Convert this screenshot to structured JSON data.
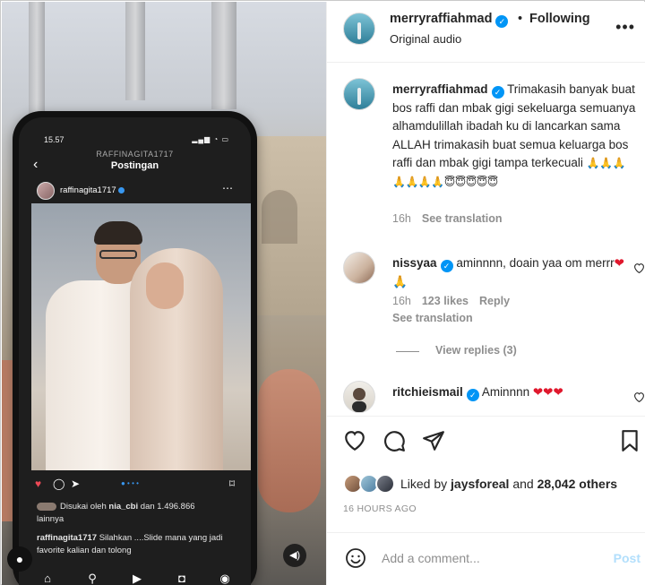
{
  "phone": {
    "status_time": "15.57",
    "nav_username": "RAFFINAGITA1717",
    "nav_title": "Postingan",
    "post_username": "raffinagita1717",
    "likes_prefix": "Disukai oleh",
    "likes_user": "nia_cbi",
    "likes_suffix": "dan 1.496.866",
    "likes_line2": "lainnya",
    "caption_user": "raffinagita1717",
    "caption_text": "Silahkan ....Slide mana yang jadi favorite kalian dan tolong"
  },
  "header": {
    "username": "merryraffiahmad",
    "separator": "•",
    "follow_state": "Following",
    "audio": "Original audio"
  },
  "caption": {
    "username": "merryraffiahmad",
    "text": "Trimakasih banyak buat bos raffi dan mbak gigi sekeluarga semuanya alhamdulillah ibadah ku di lancarkan sama ALLAH trimakasih buat semua keluarga bos raffi dan mbak gigi tampa terkecuali",
    "emojis": "🙏🙏🙏🙏🙏🙏🙏😇😇😇😇😇",
    "time": "16h",
    "see_translation": "See translation"
  },
  "comments": [
    {
      "username": "nissyaa",
      "text": "aminnnn, doain yaa om merrr",
      "emoji_heart": "❤",
      "emoji_pray": "🙏",
      "time": "16h",
      "likes": "123 likes",
      "reply": "Reply",
      "see_translation": "See translation",
      "view_replies": "View replies (3)"
    },
    {
      "username": "ritchieismail",
      "text": "Aminnnn",
      "hearts": "❤❤❤"
    }
  ],
  "likes": {
    "prefix": "Liked by",
    "user": "jaysforeal",
    "middle": "and",
    "count": "28,042 others"
  },
  "time_ago": "16 HOURS AGO",
  "add_comment": {
    "placeholder": "Add a comment...",
    "post_label": "Post"
  },
  "colors": {
    "verified": "#0095f6",
    "post_disabled": "#b2dffc",
    "heart_red": "#e0182d",
    "meta_gray": "#8e8e8e"
  }
}
